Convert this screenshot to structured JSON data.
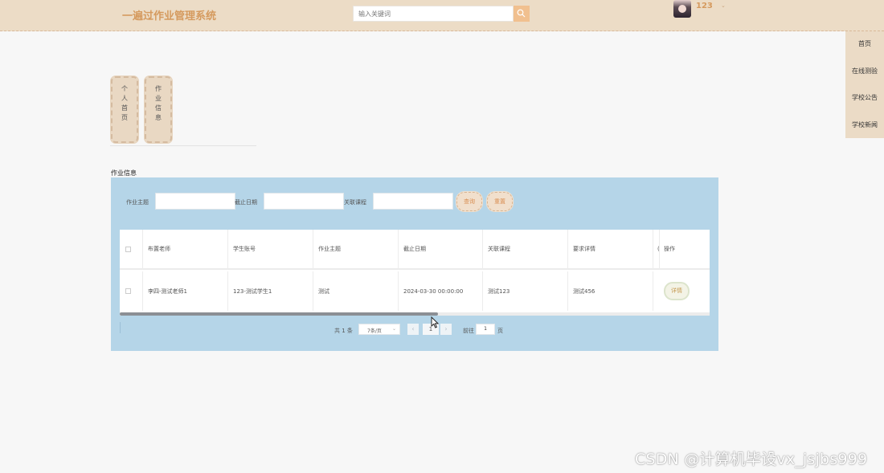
{
  "header": {
    "app_title": "一遍过作业管理系统",
    "search_placeholder": "输入关键词",
    "username": "123",
    "user_caret": "⌄"
  },
  "right_nav": {
    "items": [
      {
        "label": "首页"
      },
      {
        "label": "在线测验"
      },
      {
        "label": "学校公告"
      },
      {
        "label": "学校新闻"
      }
    ]
  },
  "side_tabs": [
    {
      "label": "个人首页"
    },
    {
      "label": "作业信息"
    }
  ],
  "section_title": "作业信息",
  "filters": {
    "topic_label": "作业主题",
    "deadline_label": "截止日期",
    "course_label": "关联课程",
    "query_button": "查询",
    "reset_button": "重置"
  },
  "table": {
    "columns": [
      "布置老师",
      "学生账号",
      "作业主题",
      "截止日期",
      "关联课程",
      "要求详情",
      "操作"
    ],
    "truncated_column_glyph": "(",
    "rows": [
      {
        "teacher": "李四-测试老师1",
        "student": "123-测试学生1",
        "topic": "测试",
        "deadline": "2024-03-30 00:00:00",
        "course": "测试123",
        "requirements": "测试456",
        "action": "详情"
      }
    ]
  },
  "pagination": {
    "total_text": "共 1 条",
    "page_size": "7条/页",
    "prev": "‹",
    "current_page": "1",
    "next": "›",
    "goto_prefix": "前往",
    "goto_value": "1",
    "goto_suffix": "页"
  },
  "watermark": "CSDN @计算机毕设vx_jsjbs999",
  "colors": {
    "header_bg": "#ecdcc6",
    "accent": "#d59a5e",
    "panel_bg": "#b5d5e8"
  }
}
